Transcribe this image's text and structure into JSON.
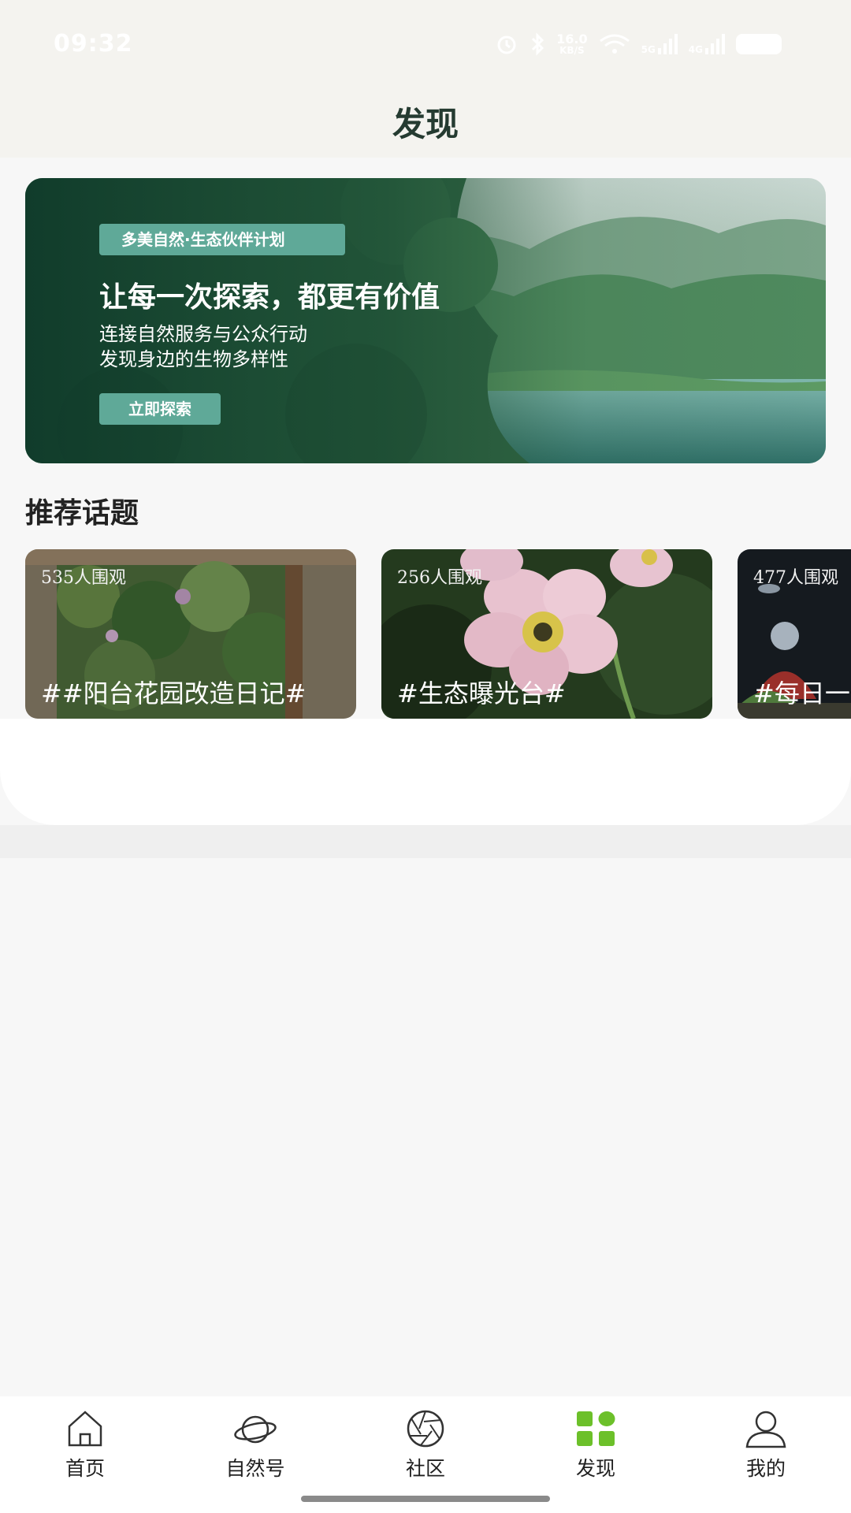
{
  "status_bar": {
    "time": "09:32",
    "network_speed": "16.0",
    "network_speed_unit": "KB/S",
    "signal_1": "5G",
    "signal_2": "4G",
    "battery": "64"
  },
  "header": {
    "title": "发现"
  },
  "banner": {
    "tag": "多美自然·生态伙伴计划",
    "title": "让每一次探索，都更有价值",
    "subtitle_line1": "连接自然服务与公众行动",
    "subtitle_line2": "发现身边的生物多样性",
    "button_label": "立即探索"
  },
  "recommended": {
    "section_title": "推荐话题",
    "topics": [
      {
        "views": "535人围观",
        "name": "##阳台花园改造日记#"
      },
      {
        "views": "256人围观",
        "name": "#生态曝光台#"
      },
      {
        "views": "477人围观",
        "name": "#每日一"
      }
    ]
  },
  "tabbar": {
    "items": [
      {
        "label": "首页",
        "icon": "home-icon"
      },
      {
        "label": "自然号",
        "icon": "planet-icon"
      },
      {
        "label": "社区",
        "icon": "aperture-icon"
      },
      {
        "label": "发现",
        "icon": "grid-icon",
        "active": true
      },
      {
        "label": "我的",
        "icon": "user-icon"
      }
    ],
    "active_color": "#6cc02a"
  }
}
